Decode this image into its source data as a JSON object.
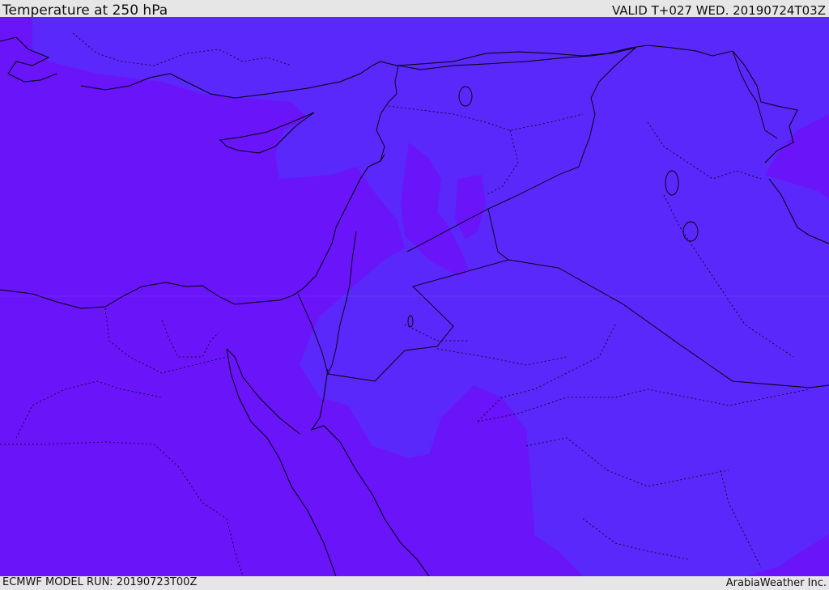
{
  "header": {
    "title": "Temperature at 250 hPa",
    "valid": "VALID T+027 WED. 20190724T03Z"
  },
  "footer": {
    "model_run": "ECMWF MODEL RUN: 20190723T00Z",
    "credit": "ArabiaWeather Inc."
  },
  "colors": {
    "warmer_field": "#6a14fa",
    "cooler_field": "#5a28fa",
    "coastline": "#000000",
    "bars": "#e6e6e6"
  }
}
